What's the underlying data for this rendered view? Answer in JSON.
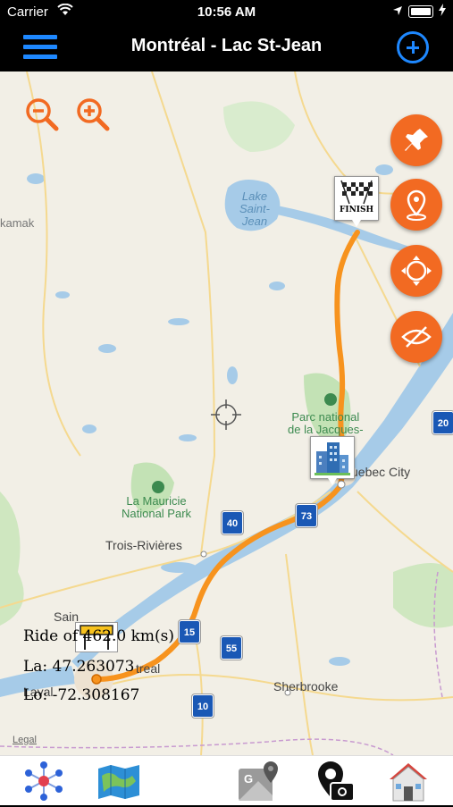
{
  "status_bar": {
    "carrier": "Carrier",
    "time": "10:56 AM"
  },
  "nav": {
    "title": "Montréal - Lac St-Jean",
    "menu_icon": "list-icon",
    "add_icon": "plus-circle-icon"
  },
  "map": {
    "labels": {
      "lake_saint_jean": "Lake\nSaint-\nJean",
      "kamak": "kamak",
      "parc_jacques_cartier": "Parc national\nde la Jacques-",
      "quebec_city": "uebec City",
      "la_mauricie": "La Mauricie\nNational Park",
      "trois_rivieres": "Trois-Rivières",
      "laval": "Laval",
      "sherbrooke": "Sherbrooke",
      "montreal_partial": "treal",
      "saint_partial": "Sain",
      "legal": "Legal"
    },
    "highways": [
      "20",
      "40",
      "73",
      "55",
      "10",
      "15"
    ],
    "start_marker": "start-sign-icon",
    "finish_marker": "FINISH",
    "city_marker": "city-buildings-icon",
    "crosshair": "crosshair-icon"
  },
  "zoom": {
    "out_icon": "zoom-out-icon",
    "in_icon": "zoom-in-icon"
  },
  "fabs": [
    "pin-icon",
    "location-marker-icon",
    "recenter-icon",
    "hide-route-icon"
  ],
  "ride_info": {
    "distance": "Ride of 462.0 km(s)",
    "latitude": "La: 47.263073",
    "longitude": "Lo: -72.308167"
  },
  "tab_bar": [
    "network-icon",
    "map-icon",
    "google-maps-icon",
    "camera-location-icon",
    "house-icon"
  ],
  "colors": {
    "accent": "#1e88ff",
    "route": "#f7931e",
    "fab": "#f26a22"
  }
}
